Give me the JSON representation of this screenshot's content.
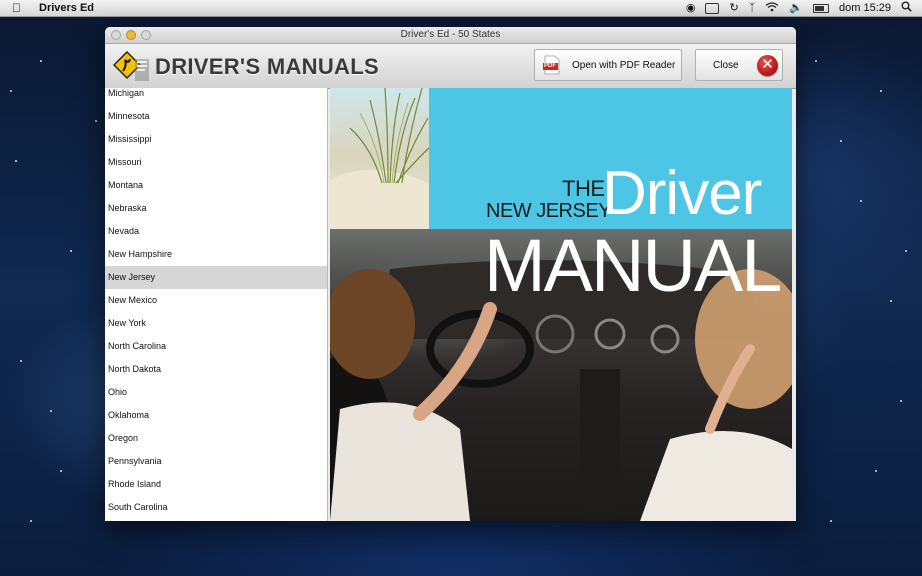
{
  "menubar": {
    "app_name": "Drivers Ed",
    "clock": "dom 15:29",
    "icons": [
      "apple-icon",
      "globe-icon",
      "battery-status-icon",
      "time-machine-icon",
      "bluetooth-icon",
      "wifi-icon",
      "volume-icon",
      "battery-icon",
      "search-icon"
    ]
  },
  "window": {
    "title": "Driver's Ed - 50 States"
  },
  "toolbar": {
    "logo_text": "DRIVER'S MANUALS",
    "pdf_badge": "PDF",
    "open_pdf_label": "Open with PDF Reader",
    "close_label": "Close",
    "close_glyph": "✕"
  },
  "states": {
    "selected": "New Jersey",
    "items": [
      "Michigan",
      "Minnesota",
      "Mississippi",
      "Missouri",
      "Montana",
      "Nebraska",
      "Nevada",
      "New Hampshire",
      "New Jersey",
      "New Mexico",
      "New York",
      "North Carolina",
      "North Dakota",
      "Ohio",
      "Oklahoma",
      "Oregon",
      "Pennsylvania",
      "Rhode Island",
      "South Carolina"
    ]
  },
  "cover": {
    "line1": "THE",
    "line2": "NEW JERSEY",
    "line3": "Driver",
    "line4": "MANUAL",
    "colors": {
      "sky": "#4dc6e6"
    }
  }
}
